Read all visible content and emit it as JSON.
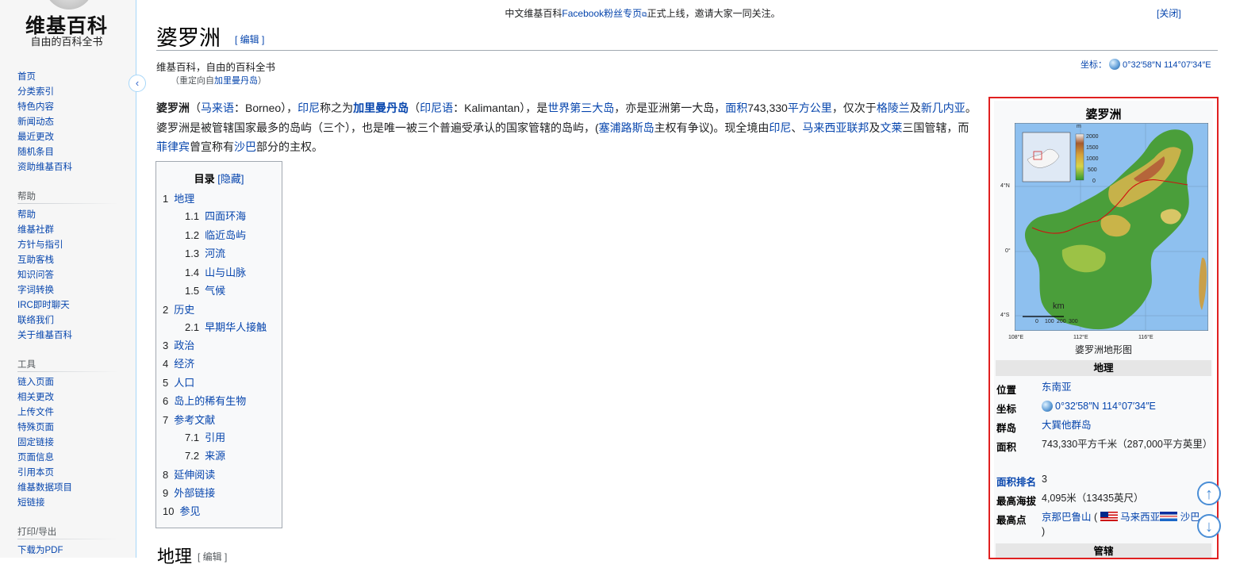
{
  "sidebar": {
    "logo_title": "维基百科",
    "logo_subtitle": "自由的百科全书",
    "nav": [
      "首页",
      "分类索引",
      "特色内容",
      "新闻动态",
      "最近更改",
      "随机条目",
      "资助维基百科"
    ],
    "help_heading": "帮助",
    "help": [
      "帮助",
      "维基社群",
      "方针与指引",
      "互助客栈",
      "知识问答",
      "字词转换",
      "IRC即时聊天",
      "联络我们",
      "关于维基百科"
    ],
    "tools_heading": "工具",
    "tools": [
      "链入页面",
      "相关更改",
      "上传文件",
      "特殊页面",
      "固定链接",
      "页面信息",
      "引用本页",
      "维基数据项目",
      "短链接"
    ],
    "print_heading": "打印/导出",
    "print": [
      "下载为PDF"
    ],
    "collapse_icon": "‹"
  },
  "notice": {
    "prefix": "中文维基百科",
    "link": "Facebook粉丝专页",
    "suffix": "正式上线，邀请大家一同关注。",
    "close": "[关闭]"
  },
  "header": {
    "title": "婆罗洲",
    "edit": "[ 编辑 ]",
    "tagline": "维基百科，自由的百科全书",
    "redirect_prefix": "（重定向自",
    "redirect_link": "加里曼丹岛",
    "redirect_suffix": "）",
    "coord_label": "坐标：",
    "coord_value": "0°32′58″N 114°07′34″E"
  },
  "lead": {
    "t1": "婆罗洲",
    "t2": "（",
    "l1": "马来语",
    "t3": "：Borneo），",
    "l2": "印尼",
    "t4": "称之为",
    "l3": "加里曼丹岛",
    "t5": "（",
    "l4": "印尼语",
    "t6": "：Kalimantan），是",
    "l5": "世界第三大岛",
    "t7": "，亦是亚洲第一大岛，",
    "l6": "面积",
    "t8": "743,330",
    "l7": "平方公里",
    "t9": "，仅次于",
    "l8": "格陵兰",
    "t10": "及",
    "l9": "新几内亚",
    "t11": "。婆罗洲是被管辖国家最多的岛屿（三个），也是唯一被三个普遍受承认的国家管辖的岛屿，(",
    "l10": "塞浦路斯岛",
    "t12": "主权有争议)。现全境由",
    "l11": "印尼",
    "t13": "、",
    "l12": "马来西亚联邦",
    "t14": "及",
    "l13": "文莱",
    "t15": "三国管辖，而",
    "l14": "菲律宾",
    "t16": "曾宣称有",
    "l15": "沙巴",
    "t17": "部分的主权。"
  },
  "toc": {
    "title": "目录",
    "toggle": "[隐藏]",
    "items": [
      {
        "num": "1",
        "label": "地理"
      },
      {
        "num": "1.1",
        "label": "四面环海"
      },
      {
        "num": "1.2",
        "label": "临近岛屿"
      },
      {
        "num": "1.3",
        "label": "河流"
      },
      {
        "num": "1.4",
        "label": "山与山脉"
      },
      {
        "num": "1.5",
        "label": "气候"
      },
      {
        "num": "2",
        "label": "历史"
      },
      {
        "num": "2.1",
        "label": "早期华人接触"
      },
      {
        "num": "3",
        "label": "政治"
      },
      {
        "num": "4",
        "label": "经济"
      },
      {
        "num": "5",
        "label": "人口"
      },
      {
        "num": "6",
        "label": "岛上的稀有生物"
      },
      {
        "num": "7",
        "label": "参考文献"
      },
      {
        "num": "7.1",
        "label": "引用"
      },
      {
        "num": "7.2",
        "label": "来源"
      },
      {
        "num": "8",
        "label": "延伸阅读"
      },
      {
        "num": "9",
        "label": "外部链接"
      },
      {
        "num": "10",
        "label": "参见"
      }
    ]
  },
  "section_heading": "地理",
  "section_edit": "[ 编辑 ]",
  "infobox": {
    "title": "婆罗洲",
    "map_labels": {
      "lat_n": "4°N",
      "lat_0": "0°",
      "lat_s": "4°S",
      "lon_1": "108°E",
      "lon_2": "112°E",
      "lon_3": "116°E",
      "legend_unit": "m",
      "legend_ticks": [
        "2000",
        "1500",
        "1000",
        "500",
        "0"
      ],
      "scale_unit": "km",
      "scale_ticks": [
        "0",
        "100",
        "200",
        "300"
      ]
    },
    "caption": "婆罗洲地形图",
    "section_geo": "地理",
    "rows": {
      "location_label": "位置",
      "location_value": "东南亚",
      "coord_label": "坐标",
      "coord_value": "0°32′58″N 114°07′34″E",
      "archipelago_label": "群岛",
      "archipelago_value": "大巽他群岛",
      "area_label": "面积",
      "area_value": "743,330平方千米（287,000平方英里）",
      "rank_label": "面积排名",
      "rank_value": "3",
      "elev_label": "最高海拔",
      "elev_value": "4,095米（13435英尺）",
      "peak_label": "最高点",
      "peak_link": "京那巴鲁山",
      "peak_open": " (",
      "peak_country": "马来西亚",
      "peak_state": "沙巴",
      "peak_close": ")"
    },
    "section_admin": "管辖"
  },
  "float_buttons": {
    "up": "↑",
    "down": "↓"
  },
  "colors": {
    "link": "#0645ad",
    "highlight_frame": "#e02020"
  }
}
